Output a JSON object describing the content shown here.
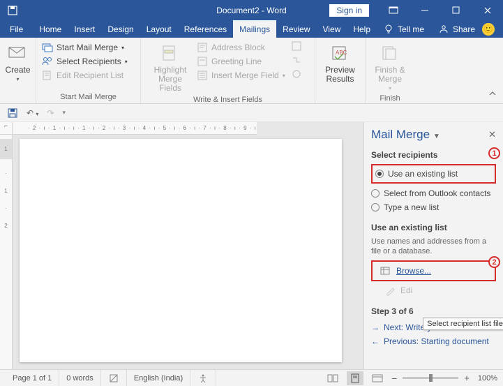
{
  "titlebar": {
    "title": "Document2 - Word",
    "signin": "Sign in"
  },
  "tabs": {
    "file": "File",
    "home": "Home",
    "insert": "Insert",
    "design": "Design",
    "layout": "Layout",
    "references": "References",
    "mailings": "Mailings",
    "review": "Review",
    "view": "View",
    "help": "Help",
    "tellme": "Tell me",
    "share": "Share"
  },
  "ribbon": {
    "create": "Create",
    "start_mail_merge": "Start Mail Merge",
    "select_recipients": "Select Recipients",
    "edit_recipient_list": "Edit Recipient List",
    "group_start": "Start Mail Merge",
    "highlight_merge_fields": "Highlight\nMerge Fields",
    "address_block": "Address Block",
    "greeting_line": "Greeting Line",
    "insert_merge_field": "Insert Merge Field",
    "group_write": "Write & Insert Fields",
    "preview_results": "Preview\nResults",
    "finish_merge": "Finish &\nMerge",
    "group_finish": "Finish"
  },
  "ruler": {
    "h": "· 2 · ı · 1 · ı ·    ı · 1 · ı · 2 · ı · 3 · ı · 4 · ı · 5 · ı · 6 · ı · 7 · ı · 8 · ı · 9 · ı",
    "v_dark": "1",
    "v1": "·",
    "v2": "1",
    "v3": "·",
    "v4": "2"
  },
  "taskpane": {
    "title": "Mail Merge",
    "section_select": "Select recipients",
    "opt_existing": "Use an existing list",
    "opt_outlook": "Select from Outlook contacts",
    "opt_new": "Type a new list",
    "section_use": "Use an existing list",
    "use_desc": "Use names and addresses from a file or a database.",
    "browse": "Browse...",
    "edit": "Edi",
    "tooltip": "Select recipient list file",
    "step": "Step 3 of 6",
    "next": "Next: Write your letter",
    "prev": "Previous: Starting document",
    "callout1": "1",
    "callout2": "2"
  },
  "statusbar": {
    "page": "Page 1 of 1",
    "words": "0 words",
    "lang": "English (India)",
    "zoom_minus": "−",
    "zoom_plus": "+",
    "zoom_pct": "100%"
  }
}
